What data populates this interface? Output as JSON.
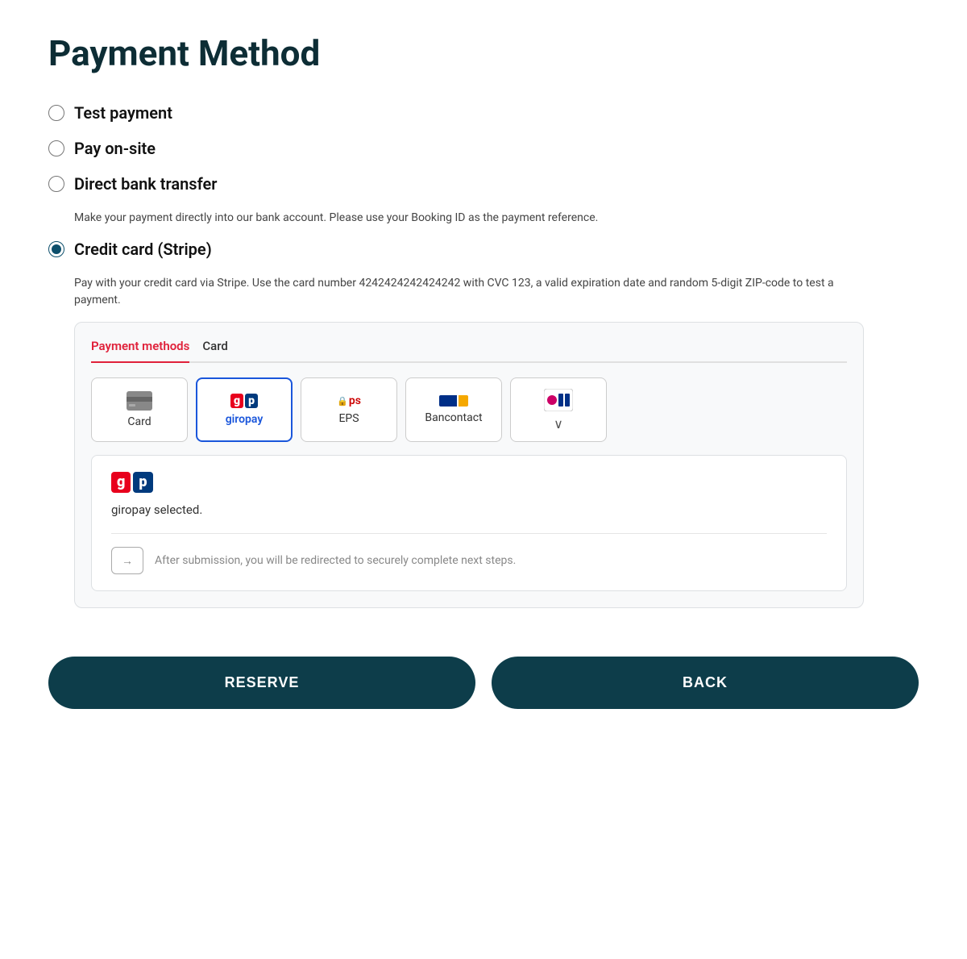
{
  "page": {
    "title": "Payment Method"
  },
  "payment_options": [
    {
      "id": "test_payment",
      "label": "Test payment",
      "selected": false,
      "description": ""
    },
    {
      "id": "pay_on_site",
      "label": "Pay on-site",
      "selected": false,
      "description": ""
    },
    {
      "id": "direct_bank",
      "label": "Direct bank transfer",
      "selected": false,
      "description": "Make your payment directly into our bank account. Please use your Booking ID as the payment reference."
    },
    {
      "id": "credit_card",
      "label": "Credit card (Stripe)",
      "selected": true,
      "description": "Pay with your credit card via Stripe. Use the card number 4242424242424242 with CVC 123, a valid expiration date and random 5-digit ZIP-code to test a payment."
    }
  ],
  "stripe": {
    "tabs": [
      {
        "id": "payment_methods",
        "label": "Payment methods",
        "active": true
      },
      {
        "id": "card",
        "label": "Card",
        "active": false
      }
    ],
    "methods": [
      {
        "id": "card",
        "label": "Card",
        "selected": false
      },
      {
        "id": "giropay",
        "label": "giropay",
        "selected": true
      },
      {
        "id": "eps",
        "label": "EPS",
        "selected": false
      },
      {
        "id": "bancontact",
        "label": "Bancontact",
        "selected": false
      },
      {
        "id": "more",
        "label": "",
        "selected": false
      }
    ],
    "selected_method": {
      "name": "giropay",
      "selected_text": "giropay selected.",
      "redirect_text": "After submission, you will be redirected to securely complete next steps."
    }
  },
  "buttons": {
    "reserve": "RESERVE",
    "back": "BACK"
  }
}
